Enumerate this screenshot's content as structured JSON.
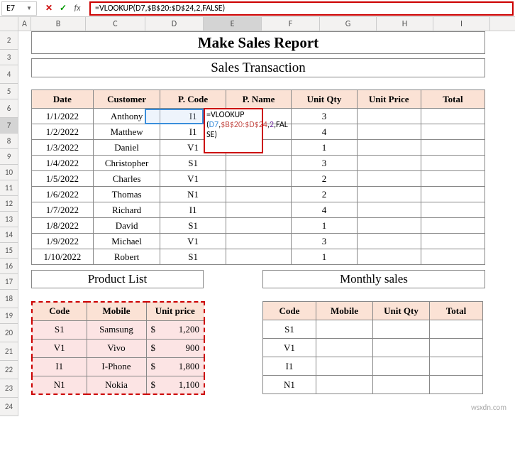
{
  "namebox": "E7",
  "formula": "=VLOOKUP(D7,$B$20:$D$24,2,FALSE)",
  "formula_parts": {
    "p1": "=VLOOKUP",
    "p2": "(",
    "d7": "D7",
    "c1": ",",
    "rng": "$B$20:$D$24",
    "c2": ",",
    "two": "2",
    "c3": ",",
    "fal": "FAL",
    "se": "SE",
    "close": ")"
  },
  "columns": [
    "A",
    "B",
    "C",
    "D",
    "E",
    "F",
    "G",
    "H",
    "I"
  ],
  "row_nums": [
    "2",
    "3",
    "4",
    "5",
    "6",
    "7",
    "8",
    "9",
    "10",
    "11",
    "12",
    "13",
    "14",
    "15",
    "16",
    "17",
    "18",
    "19",
    "20",
    "21",
    "22",
    "23",
    "24"
  ],
  "titles": {
    "main": "Make Sales Report",
    "sub": "Sales Transaction",
    "product_list": "Product List",
    "monthly_sales": "Monthly sales"
  },
  "main_headers": [
    "Date",
    "Customer",
    "P. Code",
    "P. Name",
    "Unit Qty",
    "Unit Price",
    "Total"
  ],
  "main_rows": [
    {
      "date": "1/1/2022",
      "cust": "Anthony",
      "pcode": "I1",
      "pname": "",
      "qty": "3",
      "price": "",
      "total": ""
    },
    {
      "date": "1/2/2022",
      "cust": "Matthew",
      "pcode": "I1",
      "pname": "",
      "qty": "4",
      "price": "",
      "total": ""
    },
    {
      "date": "1/3/2022",
      "cust": "Daniel",
      "pcode": "V1",
      "pname": "",
      "qty": "1",
      "price": "",
      "total": ""
    },
    {
      "date": "1/4/2022",
      "cust": "Christopher",
      "pcode": "S1",
      "pname": "",
      "qty": "3",
      "price": "",
      "total": ""
    },
    {
      "date": "1/5/2022",
      "cust": "Charles",
      "pcode": "V1",
      "pname": "",
      "qty": "2",
      "price": "",
      "total": ""
    },
    {
      "date": "1/6/2022",
      "cust": "Thomas",
      "pcode": "N1",
      "pname": "",
      "qty": "2",
      "price": "",
      "total": ""
    },
    {
      "date": "1/7/2022",
      "cust": "Richard",
      "pcode": "I1",
      "pname": "",
      "qty": "4",
      "price": "",
      "total": ""
    },
    {
      "date": "1/8/2022",
      "cust": "David",
      "pcode": "S1",
      "pname": "",
      "qty": "1",
      "price": "",
      "total": ""
    },
    {
      "date": "1/9/2022",
      "cust": "Michael",
      "pcode": "V1",
      "pname": "",
      "qty": "3",
      "price": "",
      "total": ""
    },
    {
      "date": "1/10/2022",
      "cust": "Robert",
      "pcode": "S1",
      "pname": "",
      "qty": "1",
      "price": "",
      "total": ""
    }
  ],
  "pl_headers": [
    "Code",
    "Mobile",
    "Unit price"
  ],
  "pl_rows": [
    {
      "code": "S1",
      "mobile": "Samsung",
      "cur": "$",
      "price": "1,200"
    },
    {
      "code": "V1",
      "mobile": "Vivo",
      "cur": "$",
      "price": "900"
    },
    {
      "code": "I1",
      "mobile": "I-Phone",
      "cur": "$",
      "price": "1,800"
    },
    {
      "code": "N1",
      "mobile": "Nokia",
      "cur": "$",
      "price": "1,100"
    }
  ],
  "ms_headers": [
    "Code",
    "Mobile",
    "Unit Qty",
    "Total"
  ],
  "ms_rows": [
    {
      "code": "S1"
    },
    {
      "code": "V1"
    },
    {
      "code": "I1"
    },
    {
      "code": "N1"
    }
  ],
  "watermark": "wsxdn.com"
}
